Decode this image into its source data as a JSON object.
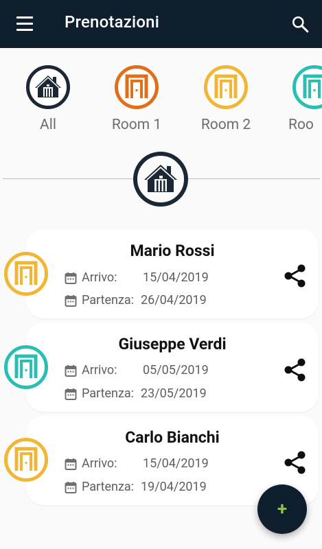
{
  "appbar": {
    "title": "Prenotazioni",
    "menu_icon": "menu-icon",
    "search_icon": "search-icon"
  },
  "filters": [
    {
      "label": "All",
      "icon": "house-icon",
      "color": "#1b2735"
    },
    {
      "label": "Room 1",
      "icon": "door-icon",
      "color": "#e06e1a"
    },
    {
      "label": "Room 2",
      "icon": "door-icon",
      "color": "#f2b636"
    },
    {
      "label": "Roo",
      "icon": "door-icon",
      "color": "#2bbfb4"
    }
  ],
  "selected_filter": {
    "icon": "house-icon",
    "color": "#1b2735"
  },
  "bookings": [
    {
      "name": "Mario Rossi",
      "arrival_label": "Arrivo:",
      "arrival": "15/04/2019",
      "departure_label": "Partenza:",
      "departure": "26/04/2019",
      "room_color": "#f2b636"
    },
    {
      "name": "Giuseppe Verdi",
      "arrival_label": "Arrivo:",
      "arrival": "05/05/2019",
      "departure_label": "Partenza:",
      "departure": "23/05/2019",
      "room_color": "#2bbfb4"
    },
    {
      "name": "Carlo Bianchi",
      "arrival_label": "Arrivo:",
      "arrival": "15/04/2019",
      "departure_label": "Partenza:",
      "departure": "19/04/2019",
      "room_color": "#f2b636"
    }
  ],
  "fab": {
    "label": "+",
    "icon": "add-icon",
    "accent": "#8bc34a"
  }
}
